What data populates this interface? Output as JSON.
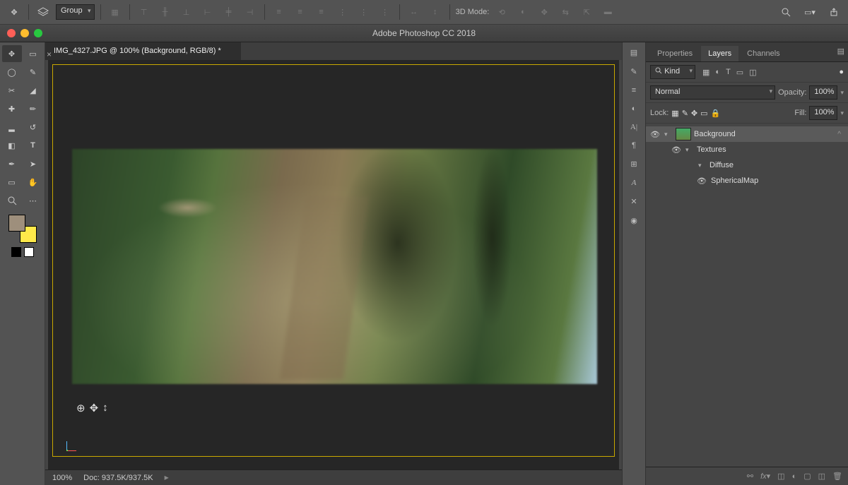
{
  "app": {
    "title": "Adobe Photoshop CC 2018"
  },
  "options_bar": {
    "group_label": "Group",
    "mode_label": "3D Mode:"
  },
  "document": {
    "tab_title": "IMG_4327.JPG @ 100% (Background, RGB/8) *"
  },
  "status": {
    "zoom": "100%",
    "doc_label": "Doc:",
    "doc_value": "937.5K/937.5K"
  },
  "panels": {
    "tabs": {
      "properties": "Properties",
      "layers": "Layers",
      "channels": "Channels"
    },
    "filter": {
      "kind": "Kind"
    },
    "blend": {
      "mode": "Normal",
      "opacity_label": "Opacity:",
      "opacity_value": "100%"
    },
    "lock": {
      "label": "Lock:",
      "fill_label": "Fill:",
      "fill_value": "100%"
    },
    "layers": [
      {
        "name": "Background",
        "visible": true,
        "expanded": true,
        "thumb": true,
        "locked": true,
        "indent": 0
      },
      {
        "name": "Textures",
        "visible": true,
        "expanded": true,
        "thumb": false,
        "indent": 1
      },
      {
        "name": "Diffuse",
        "visible": false,
        "expanded": true,
        "thumb": false,
        "indent": 2
      },
      {
        "name": "SphericalMap",
        "visible": true,
        "expanded": false,
        "thumb": false,
        "indent": 3
      }
    ]
  }
}
